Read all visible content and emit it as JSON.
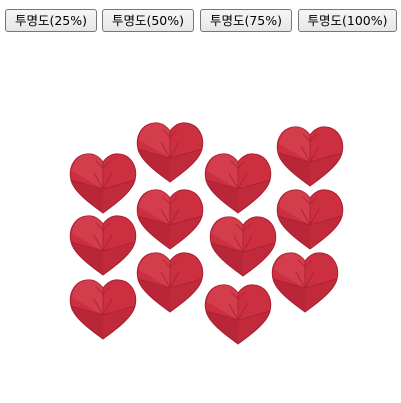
{
  "toolbar": {
    "buttons": [
      {
        "label": "투명도(25%)",
        "opacity": 0.25
      },
      {
        "label": "투명도(50%)",
        "opacity": 0.5
      },
      {
        "label": "투명도(75%)",
        "opacity": 0.75
      },
      {
        "label": "투명도(100%)",
        "opacity": 1.0
      }
    ]
  },
  "scene": {
    "heart_count": 12,
    "heart_color": "#cc3040",
    "heart_shadow_color": "#a81f31",
    "heart_highlight_color": "#e05564",
    "heart_opacity": 1.0
  }
}
